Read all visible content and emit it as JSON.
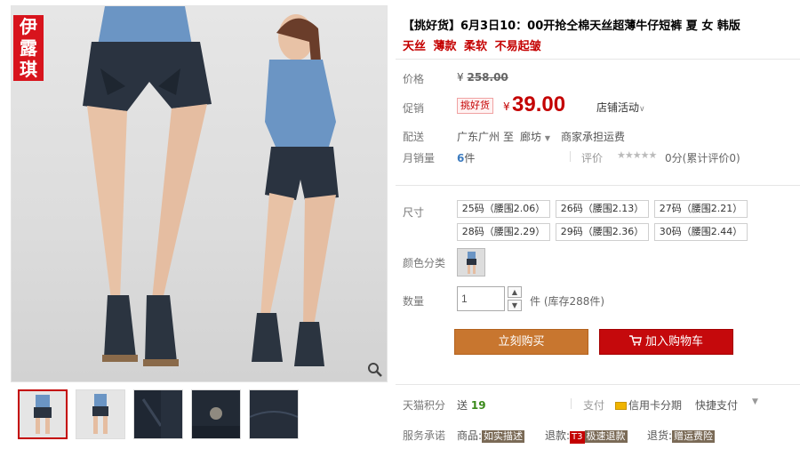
{
  "gallery": {
    "brand_logo": "伊露琪",
    "thumbnails": [
      "model-front",
      "model-side",
      "detail-pocket",
      "detail-button",
      "detail-hem"
    ]
  },
  "product": {
    "title": "【挑好货】6月3日10：00开抢仝棉天丝超薄牛仔短裤 夏 女 韩版",
    "subtitle": "天丝 薄款 柔软  不易起皱"
  },
  "price": {
    "label": "价格",
    "original": "258.00",
    "currency": "¥"
  },
  "promo": {
    "label": "促销",
    "badge": "挑好货",
    "currency": "¥",
    "price": "39.00",
    "store_activity": "店铺活动"
  },
  "shipping": {
    "label": "配送",
    "origin": "广东广州",
    "to": "至",
    "destination": "廊坊",
    "fee": "商家承担运费"
  },
  "sales": {
    "label": "月销量",
    "count": "6",
    "unit": "件",
    "rating_label": "评价",
    "rating_text": "0分(累计评价0)"
  },
  "size": {
    "label": "尺寸",
    "options": [
      "25码（腰围2.06）",
      "26码（腰围2.13）",
      "27码（腰围2.21）",
      "28码（腰围2.29）",
      "29码（腰围2.36）",
      "30码（腰围2.44）"
    ]
  },
  "color": {
    "label": "颜色分类"
  },
  "quantity": {
    "label": "数量",
    "value": "1",
    "unit": "件",
    "stock": "(库存288件)"
  },
  "actions": {
    "buy_now": "立刻购买",
    "add_to_cart": "加入购物车"
  },
  "rewards": {
    "label": "天猫积分",
    "give": "送",
    "points": "19",
    "pay_label": "支付",
    "credit_installment": "信用卡分期",
    "quick_pay": "快捷支付"
  },
  "service": {
    "label": "服务承诺",
    "goods_label": "商品:",
    "goods_tag": "如实描述",
    "refund_label": "退款:",
    "refund_tag_prefix": "T3",
    "refund_tag": "极速退款",
    "return_label": "退货:",
    "return_tag": "赠运费险"
  },
  "colors": {
    "accent": "#c40000",
    "buy_button": "#c8762f",
    "cart_button": "#c5090c"
  }
}
